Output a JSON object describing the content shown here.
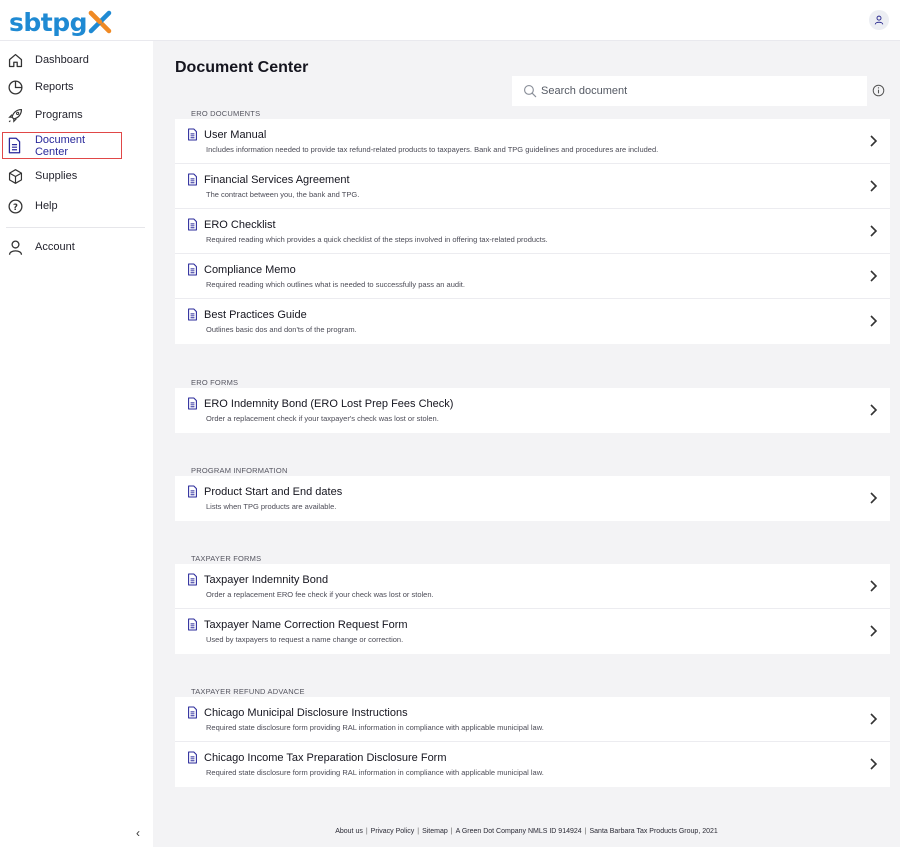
{
  "brand": {
    "logo_text": "sbtpg",
    "colors": {
      "blue": "#1f8ad3",
      "orange": "#f08a24"
    }
  },
  "header": {
    "user_icon": "user-icon"
  },
  "sidebar": {
    "items": [
      {
        "label": "Dashboard",
        "icon": "home-icon"
      },
      {
        "label": "Reports",
        "icon": "pie-chart-icon"
      },
      {
        "label": "Programs",
        "icon": "rocket-icon"
      },
      {
        "label": "Document Center",
        "icon": "document-icon",
        "active": true
      },
      {
        "label": "Supplies",
        "icon": "box-icon"
      },
      {
        "label": "Help",
        "icon": "help-circle-icon"
      },
      {
        "label": "Account",
        "icon": "user-icon"
      }
    ],
    "collapse_glyph": "‹"
  },
  "main": {
    "title": "Document Center",
    "search": {
      "placeholder": "Search document",
      "value": ""
    },
    "sections": [
      {
        "label": "ERO DOCUMENTS",
        "docs": [
          {
            "title": "User Manual",
            "desc": "Includes information needed to provide tax refund-related products to taxpayers. Bank and TPG guidelines and procedures are included."
          },
          {
            "title": "Financial Services Agreement",
            "desc": "The contract between you, the bank and TPG."
          },
          {
            "title": "ERO Checklist",
            "desc": "Required reading which provides a quick checklist of the steps involved in offering tax-related products."
          },
          {
            "title": "Compliance Memo",
            "desc": "Required reading which outlines what is needed to successfully pass an audit."
          },
          {
            "title": "Best Practices Guide",
            "desc": "Outlines basic dos and don'ts of the program."
          }
        ]
      },
      {
        "label": "ERO FORMS",
        "docs": [
          {
            "title": "ERO Indemnity Bond (ERO Lost Prep Fees Check)",
            "desc": "Order a replacement check if your taxpayer's check was lost or stolen."
          }
        ]
      },
      {
        "label": "PROGRAM INFORMATION",
        "docs": [
          {
            "title": "Product Start and End dates",
            "desc": "Lists when TPG products are available."
          }
        ]
      },
      {
        "label": "TAXPAYER FORMS",
        "docs": [
          {
            "title": "Taxpayer Indemnity Bond",
            "desc": "Order a replacement ERO fee check if your check was lost or stolen."
          },
          {
            "title": "Taxpayer Name Correction Request Form",
            "desc": "Used by taxpayers to request a name change or correction."
          }
        ]
      },
      {
        "label": "TAXPAYER REFUND ADVANCE",
        "docs": [
          {
            "title": "Chicago Municipal Disclosure Instructions",
            "desc": "Required state disclosure form providing RAL information in compliance with applicable municipal law."
          },
          {
            "title": "Chicago Income Tax Preparation Disclosure Form",
            "desc": "Required state disclosure form providing RAL information in compliance with applicable municipal law."
          }
        ]
      }
    ]
  },
  "footer": {
    "links": [
      "About us",
      "Privacy Policy",
      "Sitemap"
    ],
    "company": "A Green Dot Company NMLS ID 914924",
    "copyright": "Santa Barbara Tax Products Group, 2021",
    "separator": "|"
  }
}
